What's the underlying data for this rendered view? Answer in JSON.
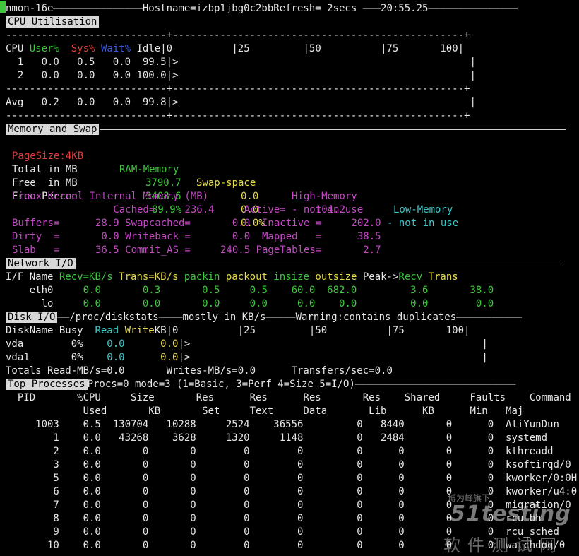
{
  "colors": {
    "bg": "#000000",
    "fg": "#e6e6e6",
    "green": "#3ec63e",
    "red": "#e23c3c",
    "blue": "#3a5ae0",
    "yellow": "#e6d94a",
    "magenta": "#c548c5",
    "cyan": "#3ec6c6",
    "header_bg": "#d8d8d8"
  },
  "title_line": "nmon-16e———————————————Hostname=izbp1jbg0c2bbRefresh= 2secs ———20:55.25———————————————",
  "cpu": {
    "header": "CPU Utilisation",
    "rule_top": "---------------------------+-------------------------------------------------+",
    "scale_tail": " Idle|0          |25         |50          |75       100|",
    "col_cpu": "CPU",
    "col_user": "User%",
    "col_sys": "Sys%",
    "col_wait": "Wait%",
    "row1": "  1   0.0   0.5   0.0  99.5|>                                                 |",
    "row2": "  2   0.0   0.0   0.0 100.0|>                                                 |",
    "rule_mid": "---------------------------+-------------------------------------------------+",
    "avg": "Avg   0.2   0.0   0.0  99.8|>                                                 |",
    "rule_bot": "---------------------------+-------------------------------------------------+"
  },
  "memory": {
    "header": "Memory and Swap",
    "pagesize": "PageSize:4KB",
    "ram": "RAM-Memory",
    "swap": "Swap-space",
    "high": "High-Memory",
    "low": "Low-Memory",
    "total_label": "Total in MB",
    "total_ram": "3790.7",
    "total_swap": "0.0",
    "not_in_use_high": "- not in use",
    "not_in_use_low": "- not in use",
    "free_label": "Free  in MB",
    "free_ram": "3408.6",
    "free_swap": "0.0",
    "freepct_label": "Free Percent",
    "freepct_ram": "89.9%",
    "freepct_swap": "0.0%",
    "kernel_title": "Linux Kernel Internal Memory (MB)",
    "k_row1": "                 Cached=     236.4     Active=     104.2",
    "k_row2": "Buffers=      28.9 Swapcached=       0.0  Inactive =     202.0",
    "k_row3": "Dirty  =       0.0 Writeback =       0.0  Mapped   =      38.5",
    "k_row4": "Slab   =      36.5 Commit_AS =     240.5 PageTables=       2.7"
  },
  "network": {
    "header": "Network I/O",
    "cols_iface": "I/F Name",
    "cols_recv": "Recv=KB/s",
    "cols_trans": "Trans=KB/s",
    "cols_packin": "packin",
    "cols_packout": "packout",
    "cols_insize": "insize",
    "cols_outsize": "outsize",
    "cols_peak": "Peak->",
    "cols_peakrecv": "Recv",
    "cols_peaktrans": "Trans",
    "eth0_name": "    eth0",
    "eth0_vals": "     0.0       0.3       0.5     0.5    60.0  682.0         3.6       38.0",
    "lo_name": "      lo",
    "lo_vals": "     0.0       0.0       0.0     0.0     0.0    0.0         0.0        0.0"
  },
  "disk": {
    "header": "Disk I/O",
    "header_tail": "——/proc/diskstats————mostly in KB/s—————Warning:contains duplicates———————————",
    "col_name_busy": "DiskName Busy  ",
    "col_read": "Read",
    "col_write": "Write",
    "col_scale": "KB|0          |25         |50          |75       100|",
    "vda_head": "vda        0%    ",
    "vda_read": "0.0",
    "vda_write": "      0.0",
    "vda_tail": "|>                                                 |",
    "vda1_head": "vda1       0%    ",
    "vda1_read": "0.0",
    "vda1_write": "      0.0",
    "vda1_tail": "|>                                                 |",
    "totals": "Totals Read-MB/s=0.0       Writes-MB/s=0.0      Transfers/sec=0.0"
  },
  "top": {
    "header": "Top Processes",
    "header_tail": "Procs=0 mode=3 (1=Basic, 3=Perf 4=Size 5=I/O)———————————————————————————",
    "head1": "  PID       %CPU     Size       Res      Res      Res       Res    Shared     Faults    Command",
    "head2": "             Used       KB       Set     Text     Data       Lib      KB      Min   Maj",
    "rows": [
      "     1003    0.5  130704   10288     2524    36556         0   8440       0      0  AliYunDun",
      "        1    0.0   43268    3628     1320     1148         0   2484       0      0  systemd",
      "        2    0.0       0       0        0        0         0      0       0      0  kthreadd",
      "        3    0.0       0       0        0        0         0      0       0      0  ksoftirqd/0",
      "        5    0.0       0       0        0        0         0      0       0      0  kworker/0:0H",
      "        6    0.0       0       0        0        0         0      0       0      0  kworker/u4:0",
      "        7    0.0       0       0        0        0         0      0       0      0  migration/0",
      "        8    0.0       0       0        0        0         0      0       0      0  rcu_bh",
      "        9    0.0       0       0        0        0         0      0       0      0  rcu_sched",
      "       10    0.0       0       0        0        0         0      0       0      0  watchdog/0"
    ]
  },
  "watermark": {
    "line1": "博为峰旗下",
    "big": "51testing",
    "cn": "软件测试网"
  }
}
